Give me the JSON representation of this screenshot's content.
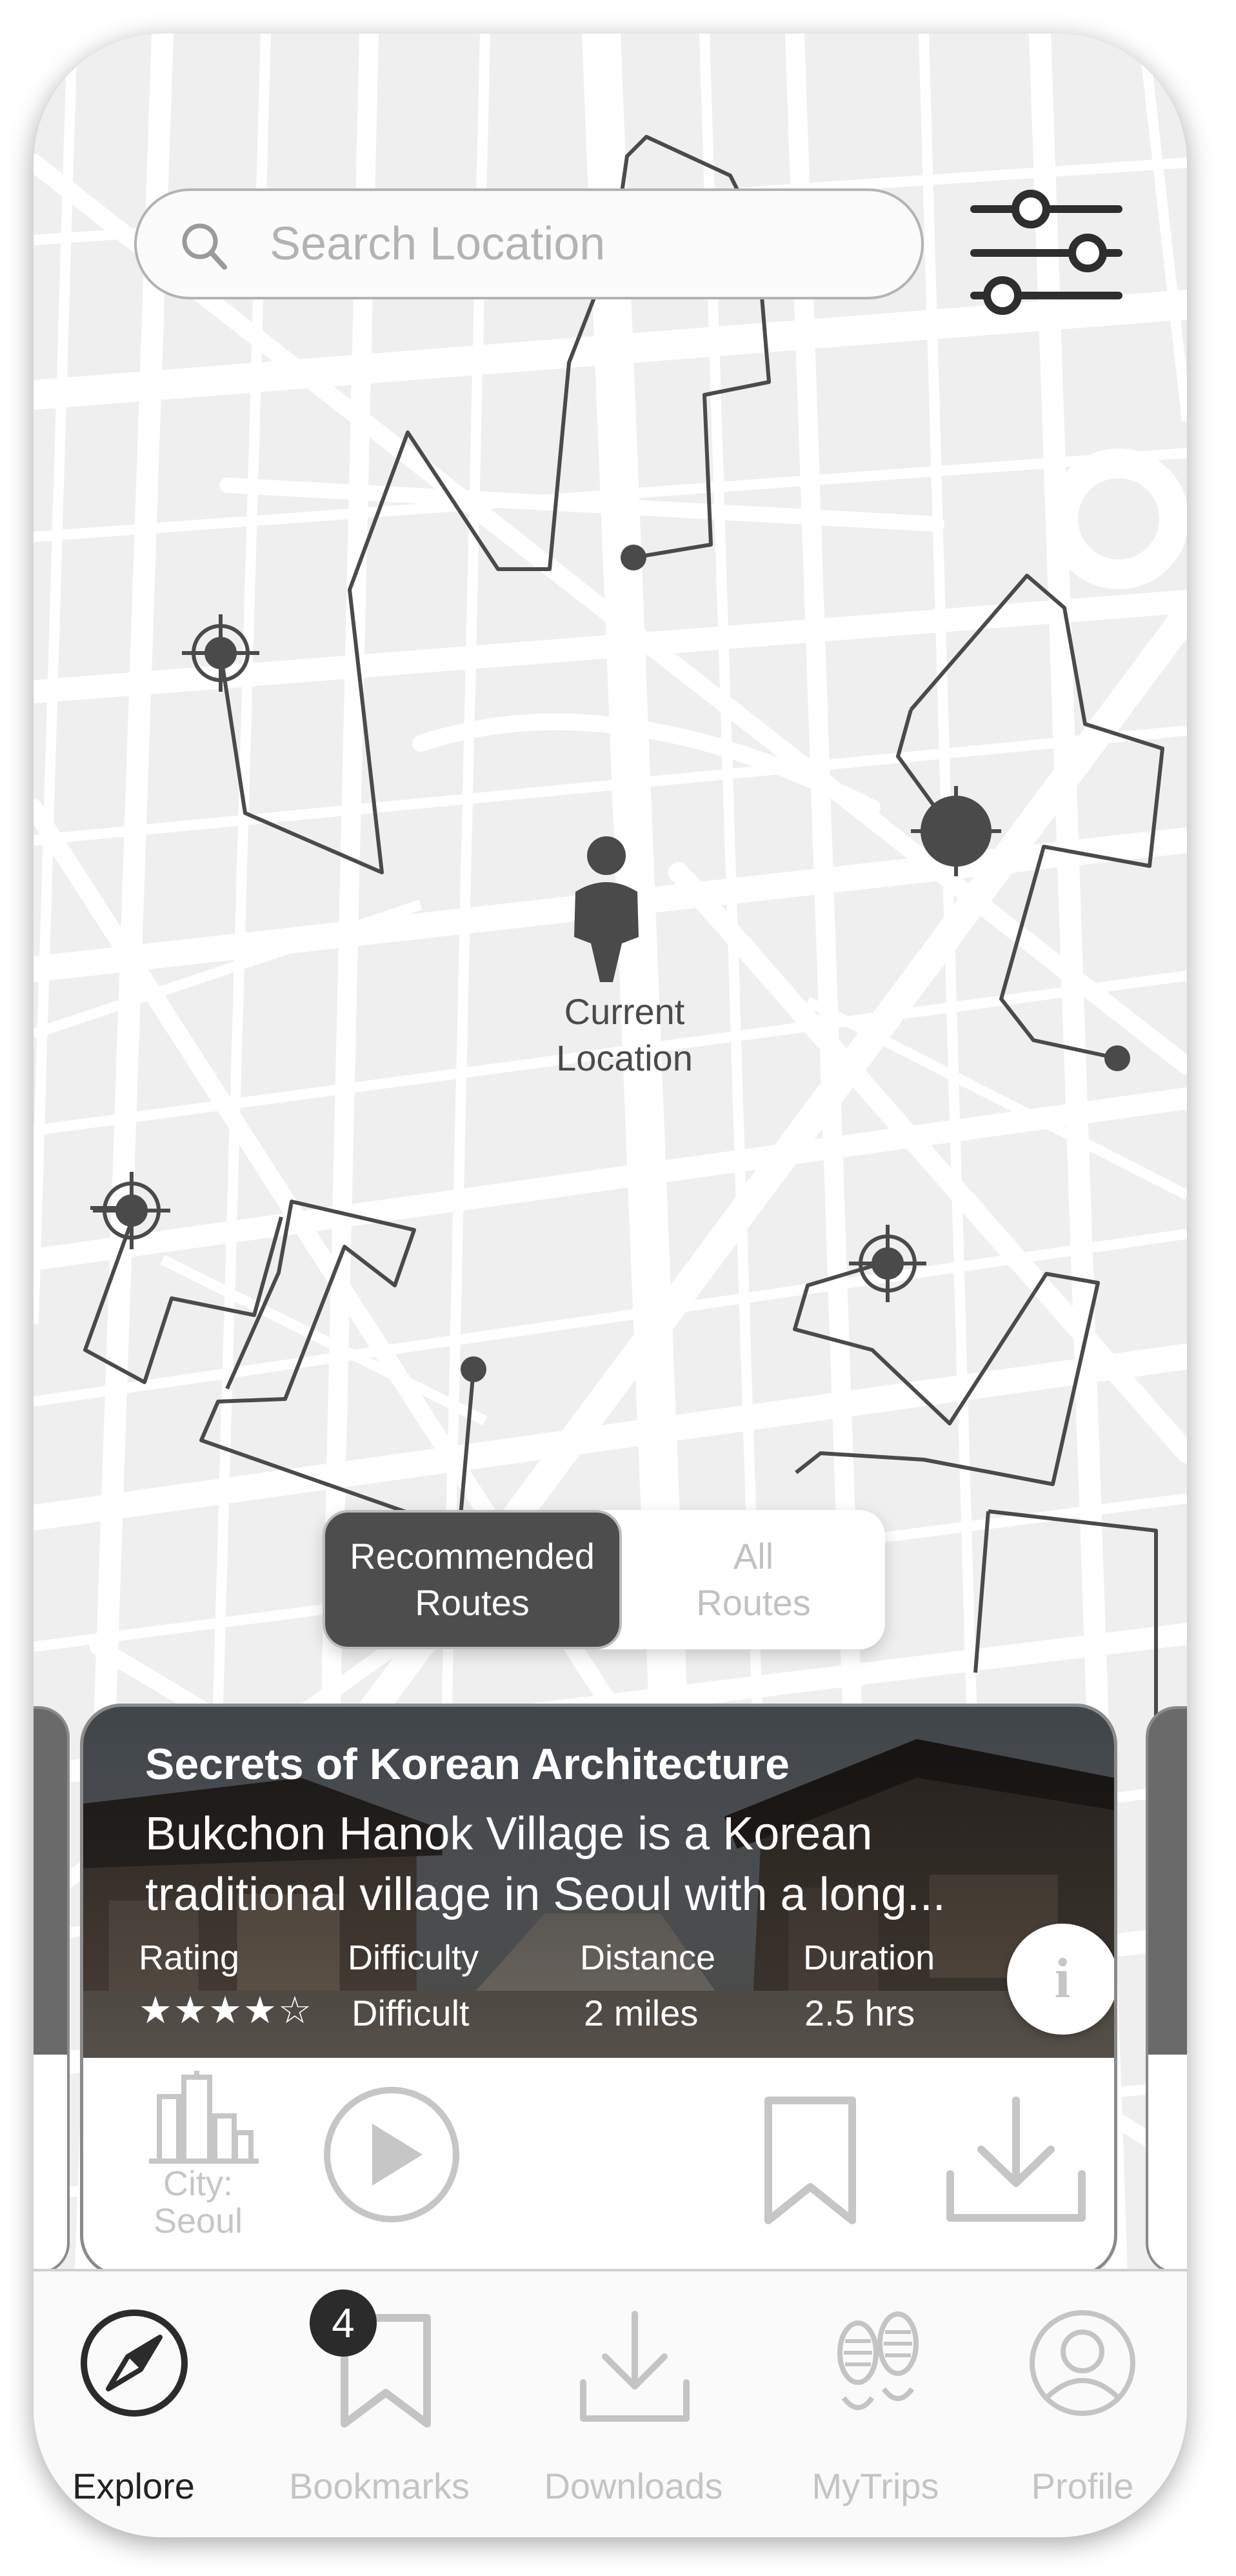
{
  "search": {
    "placeholder": "Search Location",
    "icon": "search-icon"
  },
  "filter": {
    "icon": "sliders-icon"
  },
  "map": {
    "current_location_label_line1": "Current",
    "current_location_label_line2": "Location"
  },
  "route_toggle": {
    "recommended_line1": "Recommended",
    "recommended_line2": "Routes",
    "all_line1": "All",
    "all_line2": "Routes"
  },
  "card": {
    "title": "Secrets of Korean Architecture",
    "description": "Bukchon Hanok Village is a Korean traditional village in Seoul with a long...",
    "rating_label": "Rating",
    "rating_value": 4,
    "rating_max": 5,
    "rating_stars": "★★★★☆",
    "difficulty_label": "Difficulty",
    "difficulty_value": "Difficult",
    "distance_label": "Distance",
    "distance_value": "2 miles",
    "duration_label": "Duration",
    "duration_value": "2.5 hrs",
    "info_symbol": "i",
    "city_label_line1": "City:",
    "city_label_line2": "Seoul"
  },
  "nav": {
    "items": [
      {
        "label": "Explore",
        "icon": "compass-icon",
        "active": true
      },
      {
        "label": "Bookmarks",
        "icon": "bookmark-icon",
        "badge": "4"
      },
      {
        "label": "Downloads",
        "icon": "download-icon"
      },
      {
        "label": "MyTrips",
        "icon": "footprints-icon"
      },
      {
        "label": "Profile",
        "icon": "profile-icon"
      }
    ]
  },
  "colors": {
    "map_bg": "#efefef",
    "road": "#ffffff",
    "route_line": "#4a4a4a",
    "active_segment": "#4d4d4d",
    "inactive_icon": "#c4c4c4"
  }
}
